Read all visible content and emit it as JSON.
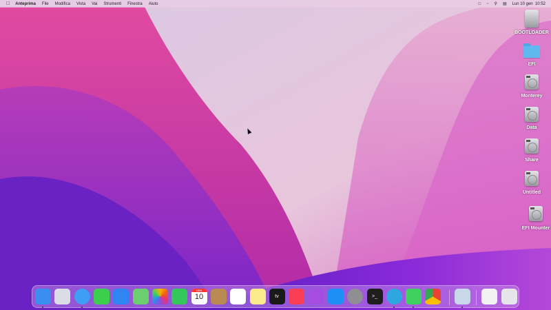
{
  "menubar": {
    "apple_icon": "apple-logo-icon",
    "app_name": "Anteprima",
    "menus": [
      "File",
      "Modifica",
      "Vista",
      "Vai",
      "Strumenti",
      "Finestra",
      "Aiuto"
    ],
    "status_icons": [
      "screen-mirroring-icon",
      "wifi-icon",
      "spotlight-search-icon",
      "control-center-icon"
    ],
    "clock": "Lun 10 gen  10:52"
  },
  "desktop_items": [
    {
      "label": "BOOTLOADER",
      "icon": "external-drive-icon"
    },
    {
      "label": "EFI",
      "icon": "folder-icon"
    },
    {
      "label": "Monterey",
      "icon": "hard-drive-icon"
    },
    {
      "label": "Data",
      "icon": "hard-drive-icon"
    },
    {
      "label": "Share",
      "icon": "hard-drive-icon"
    },
    {
      "label": "Untitled",
      "icon": "hard-drive-icon"
    },
    {
      "label": "EFI Mounter",
      "icon": "hard-drive-icon"
    }
  ],
  "dock": {
    "items": [
      {
        "name": "Finder",
        "running": true,
        "color": "#3a8ef0"
      },
      {
        "name": "Launchpad",
        "running": false,
        "color": "#dcdce6"
      },
      {
        "name": "Safari",
        "running": true,
        "color": "#3e9ef5"
      },
      {
        "name": "Messaggi",
        "running": false,
        "color": "#3ccf4e"
      },
      {
        "name": "Mail",
        "running": false,
        "color": "#2f86f2"
      },
      {
        "name": "Mappe",
        "running": false,
        "color": "#6ccf70"
      },
      {
        "name": "Foto",
        "running": false,
        "color": "#ffffff"
      },
      {
        "name": "FaceTime",
        "running": false,
        "color": "#34c759"
      },
      {
        "name": "Calendario",
        "running": false,
        "color": "#ffffff",
        "month": "GEN",
        "day": "10"
      },
      {
        "name": "Contatti",
        "running": false,
        "color": "#b98a52"
      },
      {
        "name": "Promemoria",
        "running": false,
        "color": "#ffffff"
      },
      {
        "name": "Note",
        "running": false,
        "color": "#fbe98a"
      },
      {
        "name": "TV",
        "running": false,
        "color": "#1a1a1a",
        "text": "tv"
      },
      {
        "name": "Musica",
        "running": false,
        "color": "#fa3e55"
      },
      {
        "name": "Podcast",
        "running": false,
        "color": "#a44de0"
      },
      {
        "name": "App Store",
        "running": false,
        "color": "#1d8ff5"
      },
      {
        "name": "Preferenze di Sistema",
        "running": false,
        "color": "#8e8e93"
      },
      {
        "name": "Terminale",
        "running": false,
        "color": "#1e1e1e",
        "text": ">_"
      },
      {
        "name": "Telegram",
        "running": true,
        "color": "#2ea6e0"
      },
      {
        "name": "WhatsApp",
        "running": true,
        "color": "#3ed160"
      },
      {
        "name": "Chrome",
        "running": false,
        "color": "#ffffff"
      },
      {
        "name": "Anteprima",
        "running": true,
        "color": "#c8d8ea"
      },
      {
        "name": "Documento",
        "running": false,
        "color": "#f2f2f2"
      },
      {
        "name": "Cestino",
        "running": false,
        "color": "#e6e6ea"
      }
    ]
  }
}
